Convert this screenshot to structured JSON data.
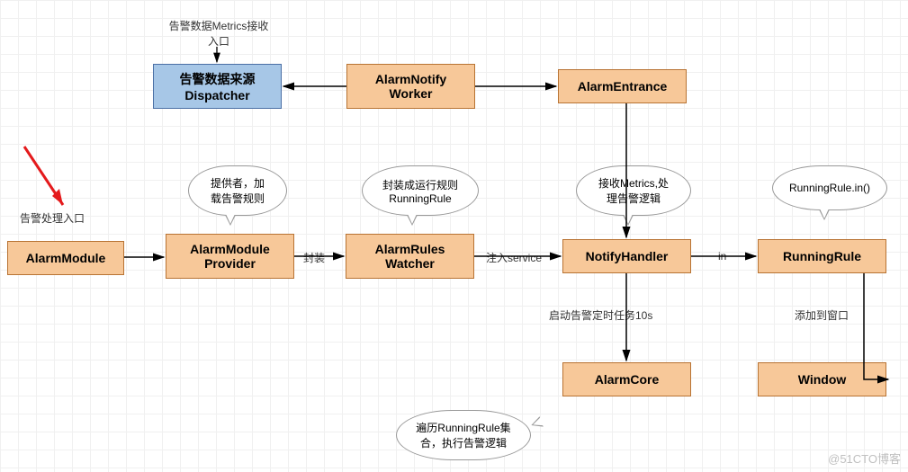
{
  "nodes": {
    "dispatcher": "告警数据来源\nDispatcher",
    "alarmNotifyWorker": "AlarmNotify\nWorker",
    "alarmEntrance": "AlarmEntrance",
    "alarmModule": "AlarmModule",
    "alarmModuleProvider": "AlarmModule\nProvider",
    "alarmRulesWatcher": "AlarmRules\nWatcher",
    "notifyHandler": "NotifyHandler",
    "runningRule": "RunningRule",
    "alarmCore": "AlarmCore",
    "window": "Window"
  },
  "edges": {
    "fengzhuang": "封装",
    "zhuru": "注入service",
    "in": "in",
    "qidong": "启动告警定时任务10s",
    "tianjia": "添加到窗口"
  },
  "callouts": {
    "entry1": "告警数据Metrics接收\n入口",
    "entry2": "告警处理入口",
    "provider": "提供者，加\n载告警规则",
    "watcher": "封装成运行规则\nRunningRule",
    "notify": "接收Metrics,处\n理告警逻辑",
    "running": "RunningRule.in()",
    "core": "遍历RunningRule集\n合，执行告警逻辑"
  },
  "watermark": "@51CTO博客"
}
